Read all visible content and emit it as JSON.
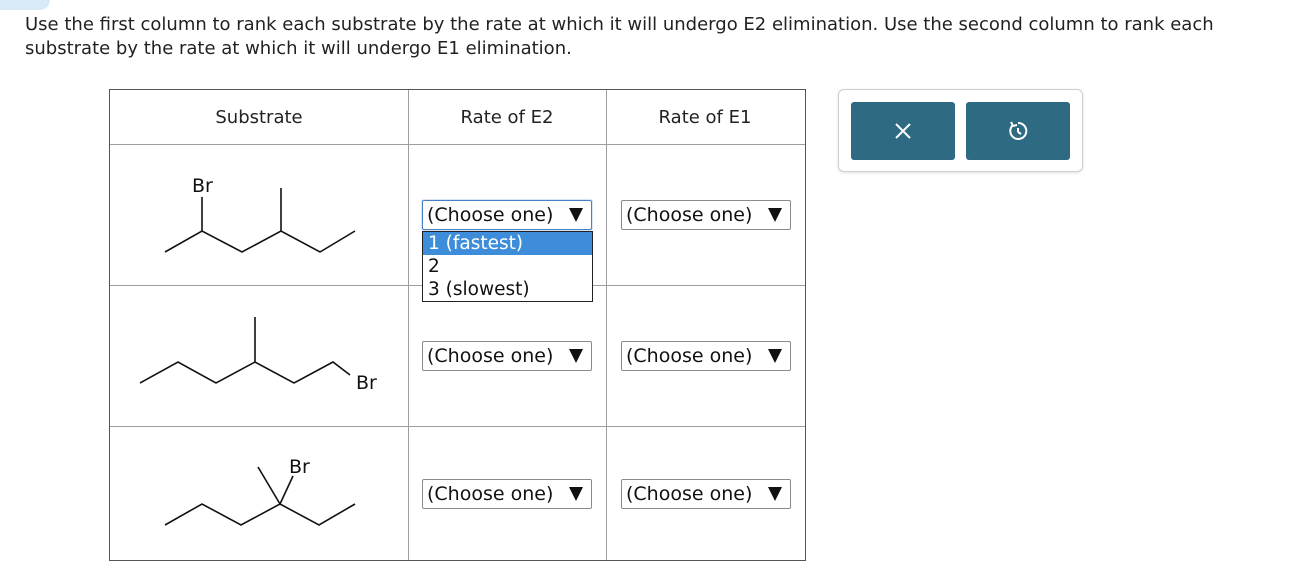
{
  "instructions": "Use the first column to rank each substrate by the rate at which it will undergo E2 elimination. Use the second column to rank each substrate by the rate at which it will undergo E1 elimination.",
  "table": {
    "headers": {
      "substrate": "Substrate",
      "e2": "Rate of E2",
      "e1": "Rate of E1"
    },
    "rows": [
      {
        "br_label": "Br",
        "e2_value": "(Choose one)",
        "e1_value": "(Choose one)"
      },
      {
        "br_label": "Br",
        "e2_value": "(Choose one)",
        "e1_value": "(Choose one)"
      },
      {
        "br_label": "Br",
        "e2_value": "(Choose one)",
        "e1_value": "(Choose one)"
      }
    ]
  },
  "dropdown": {
    "options": [
      "1 (fastest)",
      "2",
      "3 (slowest)"
    ],
    "highlighted": "1 (fastest)"
  },
  "tools": {
    "clear_icon": "close-icon",
    "reset_icon": "undo-icon",
    "button_color": "#2e6b82"
  }
}
